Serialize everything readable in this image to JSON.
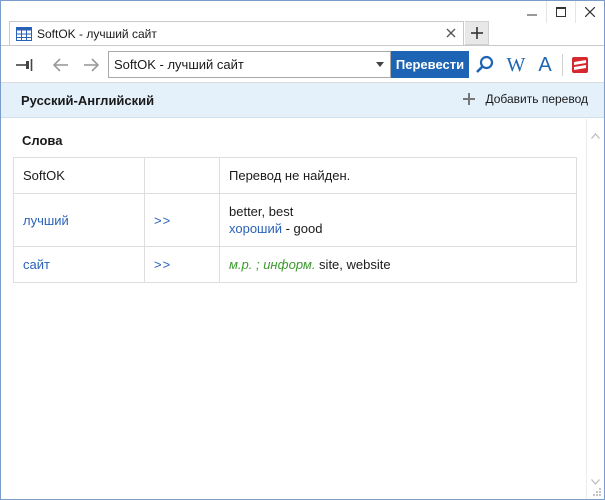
{
  "window": {
    "tab_title": "SoftOK - лучший сайт"
  },
  "toolbar": {
    "search_value": "SoftOK - лучший сайт",
    "translate_label": "Перевести",
    "wiki_letter": "W",
    "dict_letter": "A"
  },
  "langbar": {
    "title": "Русский-Английский",
    "add_translation": "Добавить перевод"
  },
  "words": {
    "section_title": "Слова",
    "rows": [
      {
        "word": "SoftOK",
        "arrow": "",
        "lines": [
          {
            "text": "Перевод не найден."
          }
        ]
      },
      {
        "word": "лучший",
        "arrow": ">>",
        "lines": [
          {
            "text": "better, best"
          },
          {
            "link": "хороший",
            "text": " - good"
          }
        ]
      },
      {
        "word": "сайт",
        "arrow": ">>",
        "lines": [
          {
            "gram": "м.р. ; информ.",
            "text": " site, website"
          }
        ]
      }
    ]
  },
  "colors": {
    "accent": "#1e64b4",
    "link": "#2a62b8",
    "grammar": "#3c9a2e",
    "header_bg": "#e4f1fb"
  }
}
